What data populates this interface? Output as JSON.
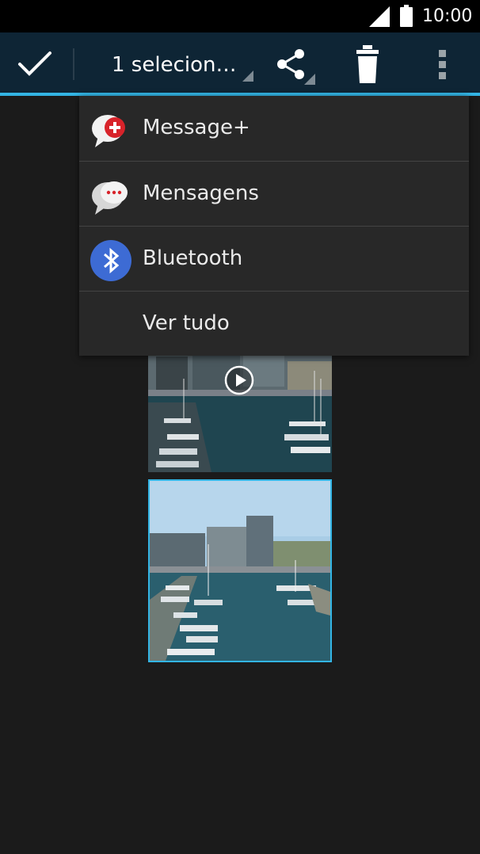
{
  "status_bar": {
    "time": "10:00",
    "icons": [
      "signal-icon",
      "battery-icon"
    ]
  },
  "action_bar": {
    "done_icon": "check-icon",
    "selection_label": "1 selecion…",
    "share_icon": "share-icon",
    "delete_icon": "trash-icon",
    "overflow_icon": "more-vert-icon"
  },
  "share_menu": {
    "items": [
      {
        "label": "Message+",
        "icon": "message-plus-icon"
      },
      {
        "label": "Mensagens",
        "icon": "messages-icon"
      },
      {
        "label": "Bluetooth",
        "icon": "bluetooth-icon"
      },
      {
        "label": "Ver tudo"
      }
    ]
  },
  "gallery": {
    "items": [
      {
        "type": "video",
        "selected": false,
        "icon": "play-icon"
      },
      {
        "type": "photo",
        "selected": true
      }
    ]
  },
  "colors": {
    "accent": "#33b5e5",
    "action_bar_bg": "#0e2535",
    "menu_bg": "#282828",
    "page_bg": "#1b1b1b"
  }
}
